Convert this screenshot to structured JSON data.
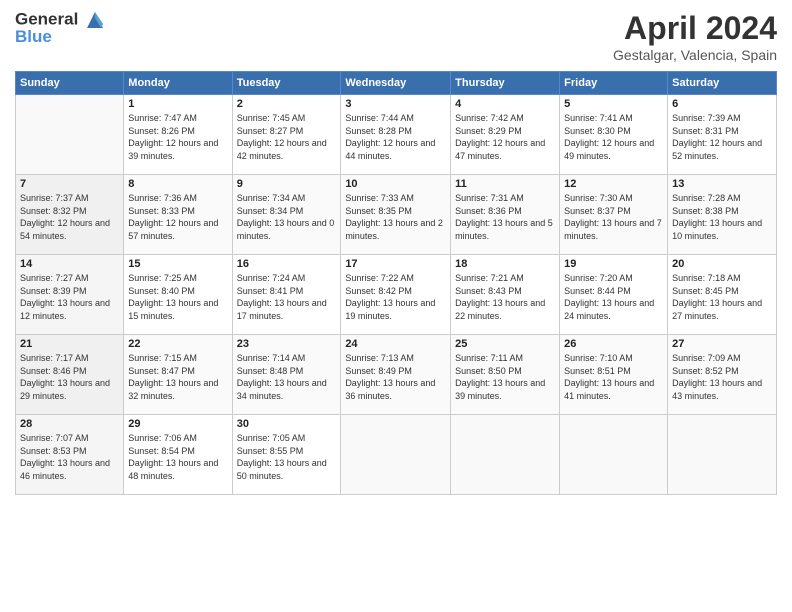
{
  "header": {
    "logo_general": "General",
    "logo_blue": "Blue",
    "month_title": "April 2024",
    "subtitle": "Gestalgar, Valencia, Spain"
  },
  "weekdays": [
    "Sunday",
    "Monday",
    "Tuesday",
    "Wednesday",
    "Thursday",
    "Friday",
    "Saturday"
  ],
  "weeks": [
    [
      {
        "day": "",
        "sunrise": "",
        "sunset": "",
        "daylight": ""
      },
      {
        "day": "1",
        "sunrise": "Sunrise: 7:47 AM",
        "sunset": "Sunset: 8:26 PM",
        "daylight": "Daylight: 12 hours and 39 minutes."
      },
      {
        "day": "2",
        "sunrise": "Sunrise: 7:45 AM",
        "sunset": "Sunset: 8:27 PM",
        "daylight": "Daylight: 12 hours and 42 minutes."
      },
      {
        "day": "3",
        "sunrise": "Sunrise: 7:44 AM",
        "sunset": "Sunset: 8:28 PM",
        "daylight": "Daylight: 12 hours and 44 minutes."
      },
      {
        "day": "4",
        "sunrise": "Sunrise: 7:42 AM",
        "sunset": "Sunset: 8:29 PM",
        "daylight": "Daylight: 12 hours and 47 minutes."
      },
      {
        "day": "5",
        "sunrise": "Sunrise: 7:41 AM",
        "sunset": "Sunset: 8:30 PM",
        "daylight": "Daylight: 12 hours and 49 minutes."
      },
      {
        "day": "6",
        "sunrise": "Sunrise: 7:39 AM",
        "sunset": "Sunset: 8:31 PM",
        "daylight": "Daylight: 12 hours and 52 minutes."
      }
    ],
    [
      {
        "day": "7",
        "sunrise": "Sunrise: 7:37 AM",
        "sunset": "Sunset: 8:32 PM",
        "daylight": "Daylight: 12 hours and 54 minutes."
      },
      {
        "day": "8",
        "sunrise": "Sunrise: 7:36 AM",
        "sunset": "Sunset: 8:33 PM",
        "daylight": "Daylight: 12 hours and 57 minutes."
      },
      {
        "day": "9",
        "sunrise": "Sunrise: 7:34 AM",
        "sunset": "Sunset: 8:34 PM",
        "daylight": "Daylight: 13 hours and 0 minutes."
      },
      {
        "day": "10",
        "sunrise": "Sunrise: 7:33 AM",
        "sunset": "Sunset: 8:35 PM",
        "daylight": "Daylight: 13 hours and 2 minutes."
      },
      {
        "day": "11",
        "sunrise": "Sunrise: 7:31 AM",
        "sunset": "Sunset: 8:36 PM",
        "daylight": "Daylight: 13 hours and 5 minutes."
      },
      {
        "day": "12",
        "sunrise": "Sunrise: 7:30 AM",
        "sunset": "Sunset: 8:37 PM",
        "daylight": "Daylight: 13 hours and 7 minutes."
      },
      {
        "day": "13",
        "sunrise": "Sunrise: 7:28 AM",
        "sunset": "Sunset: 8:38 PM",
        "daylight": "Daylight: 13 hours and 10 minutes."
      }
    ],
    [
      {
        "day": "14",
        "sunrise": "Sunrise: 7:27 AM",
        "sunset": "Sunset: 8:39 PM",
        "daylight": "Daylight: 13 hours and 12 minutes."
      },
      {
        "day": "15",
        "sunrise": "Sunrise: 7:25 AM",
        "sunset": "Sunset: 8:40 PM",
        "daylight": "Daylight: 13 hours and 15 minutes."
      },
      {
        "day": "16",
        "sunrise": "Sunrise: 7:24 AM",
        "sunset": "Sunset: 8:41 PM",
        "daylight": "Daylight: 13 hours and 17 minutes."
      },
      {
        "day": "17",
        "sunrise": "Sunrise: 7:22 AM",
        "sunset": "Sunset: 8:42 PM",
        "daylight": "Daylight: 13 hours and 19 minutes."
      },
      {
        "day": "18",
        "sunrise": "Sunrise: 7:21 AM",
        "sunset": "Sunset: 8:43 PM",
        "daylight": "Daylight: 13 hours and 22 minutes."
      },
      {
        "day": "19",
        "sunrise": "Sunrise: 7:20 AM",
        "sunset": "Sunset: 8:44 PM",
        "daylight": "Daylight: 13 hours and 24 minutes."
      },
      {
        "day": "20",
        "sunrise": "Sunrise: 7:18 AM",
        "sunset": "Sunset: 8:45 PM",
        "daylight": "Daylight: 13 hours and 27 minutes."
      }
    ],
    [
      {
        "day": "21",
        "sunrise": "Sunrise: 7:17 AM",
        "sunset": "Sunset: 8:46 PM",
        "daylight": "Daylight: 13 hours and 29 minutes."
      },
      {
        "day": "22",
        "sunrise": "Sunrise: 7:15 AM",
        "sunset": "Sunset: 8:47 PM",
        "daylight": "Daylight: 13 hours and 32 minutes."
      },
      {
        "day": "23",
        "sunrise": "Sunrise: 7:14 AM",
        "sunset": "Sunset: 8:48 PM",
        "daylight": "Daylight: 13 hours and 34 minutes."
      },
      {
        "day": "24",
        "sunrise": "Sunrise: 7:13 AM",
        "sunset": "Sunset: 8:49 PM",
        "daylight": "Daylight: 13 hours and 36 minutes."
      },
      {
        "day": "25",
        "sunrise": "Sunrise: 7:11 AM",
        "sunset": "Sunset: 8:50 PM",
        "daylight": "Daylight: 13 hours and 39 minutes."
      },
      {
        "day": "26",
        "sunrise": "Sunrise: 7:10 AM",
        "sunset": "Sunset: 8:51 PM",
        "daylight": "Daylight: 13 hours and 41 minutes."
      },
      {
        "day": "27",
        "sunrise": "Sunrise: 7:09 AM",
        "sunset": "Sunset: 8:52 PM",
        "daylight": "Daylight: 13 hours and 43 minutes."
      }
    ],
    [
      {
        "day": "28",
        "sunrise": "Sunrise: 7:07 AM",
        "sunset": "Sunset: 8:53 PM",
        "daylight": "Daylight: 13 hours and 46 minutes."
      },
      {
        "day": "29",
        "sunrise": "Sunrise: 7:06 AM",
        "sunset": "Sunset: 8:54 PM",
        "daylight": "Daylight: 13 hours and 48 minutes."
      },
      {
        "day": "30",
        "sunrise": "Sunrise: 7:05 AM",
        "sunset": "Sunset: 8:55 PM",
        "daylight": "Daylight: 13 hours and 50 minutes."
      },
      {
        "day": "",
        "sunrise": "",
        "sunset": "",
        "daylight": ""
      },
      {
        "day": "",
        "sunrise": "",
        "sunset": "",
        "daylight": ""
      },
      {
        "day": "",
        "sunrise": "",
        "sunset": "",
        "daylight": ""
      },
      {
        "day": "",
        "sunrise": "",
        "sunset": "",
        "daylight": ""
      }
    ]
  ]
}
